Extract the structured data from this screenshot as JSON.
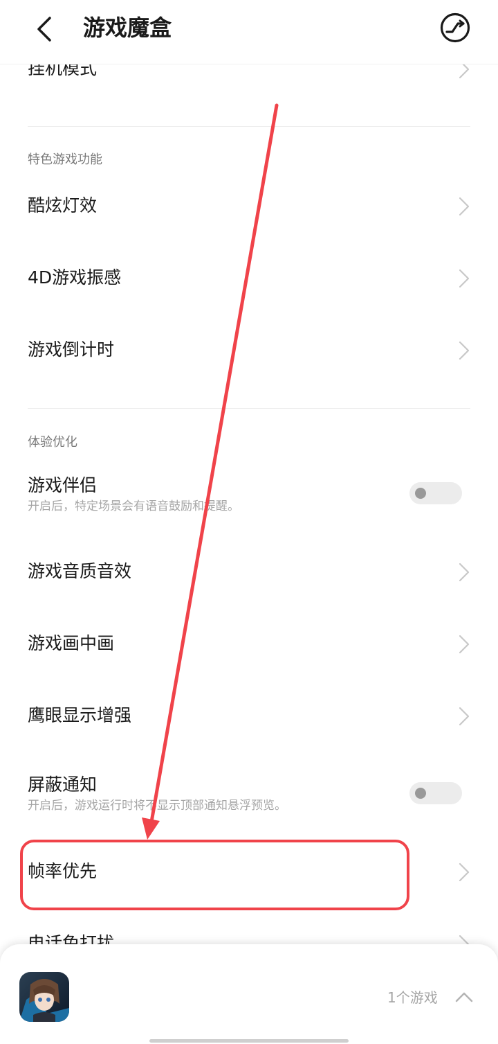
{
  "header": {
    "title": "游戏魔盒",
    "back_icon": "chevron-left-icon",
    "right_icon": "performance-circle-icon"
  },
  "rows": {
    "hang_mode": "挂机模式",
    "cool_lights": "酷炫灯效",
    "vibration_4d": "4D游戏振感",
    "countdown": "游戏倒计时",
    "companion": "游戏伴侣",
    "companion_sub": "开启后，特定场景会有语音鼓励和提醒。",
    "audio": "游戏音质音效",
    "pip": "游戏画中画",
    "eagle_eye": "鹰眼显示增强",
    "block_notify": "屏蔽通知",
    "block_notify_sub": "开启后，游戏运行时将不显示顶部通知悬浮预览。",
    "frame_rate": "帧率优先",
    "call_disturb": "电话免打扰"
  },
  "sections": {
    "special": "特色游戏功能",
    "experience": "体验优化"
  },
  "toggles": {
    "companion_on": false,
    "block_notify_on": false
  },
  "bottom_bar": {
    "game_count": "1个游戏",
    "expand_icon": "chevron-up-icon"
  },
  "colors": {
    "annotation": "#f0434a",
    "subtext": "#a6a6a6"
  }
}
